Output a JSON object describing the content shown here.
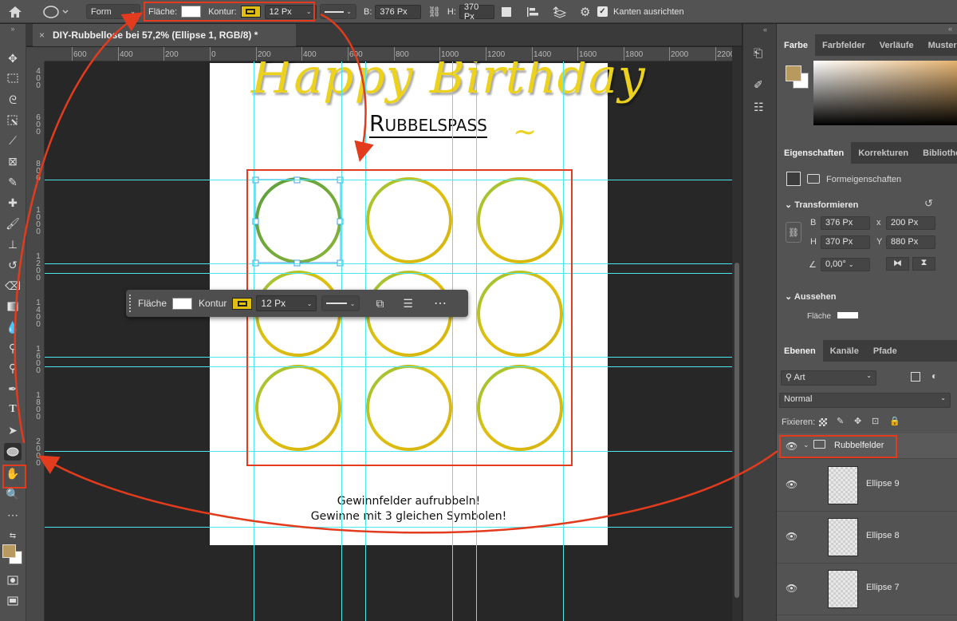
{
  "options_bar": {
    "mode": "Form",
    "fill_label": "Fläche:",
    "stroke_label": "Kontur:",
    "stroke_width": "12 Px",
    "width_label": "B:",
    "width_value": "376 Px",
    "height_label": "H:",
    "height_value": "370 Px",
    "align_edges_label": "Kanten ausrichten",
    "align_edges_checked": true
  },
  "tab": {
    "title": "DIY-Rubbellose bei 57,2% (Ellipse 1, RGB/8) *",
    "close": "×"
  },
  "rulers": {
    "horizontal": [
      "600",
      "400",
      "200",
      "0",
      "200",
      "400",
      "600",
      "800",
      "1000",
      "1200",
      "1400",
      "1600",
      "1800",
      "2000",
      "2200"
    ],
    "vertical": [
      "400",
      "600",
      "800",
      "1000",
      "1200",
      "1400",
      "1600",
      "1800",
      "2000"
    ]
  },
  "document": {
    "title_script": "Happy Birthday",
    "subtitle": "Rubbelspaß",
    "footer_line1": "Gewinnfelder aufrubbeln!",
    "footer_line2": "Gewinne mit 3 gleichen Symbolen!"
  },
  "contextual_bar": {
    "fill_label": "Fläche",
    "stroke_label": "Kontur",
    "stroke_width": "12 Px"
  },
  "color_panel": {
    "tabs": [
      "Farbe",
      "Farbfelder",
      "Verläufe",
      "Muster"
    ],
    "foreground": "#b89a5f",
    "background": "#ffffff"
  },
  "properties_panel": {
    "tabs": [
      "Eigenschaften",
      "Korrekturen",
      "Bibliothe"
    ],
    "kind": "Formeigenschaften",
    "transform_heading": "Transformieren",
    "w_label": "B",
    "w_value": "376 Px",
    "x_label": "x",
    "x_value": "200 Px",
    "h_label": "H",
    "h_value": "370 Px",
    "y_label": "Y",
    "y_value": "880 Px",
    "angle_value": "0,00°",
    "appearance_heading": "Aussehen",
    "fill_label": "Fläche"
  },
  "layers_panel": {
    "tabs": [
      "Ebenen",
      "Kanäle",
      "Pfade"
    ],
    "filter_kind": "Art",
    "blend_mode": "Normal",
    "lock_label": "Fixieren:",
    "group": "Rubbelfelder",
    "layers": [
      "Ellipse 9",
      "Ellipse 8",
      "Ellipse 7"
    ]
  },
  "colors": {
    "guide": "#4ce6ee",
    "annotation": "#e23b1d",
    "stroke_gold": "#e0bf10",
    "stroke_green": "#8cc63f"
  }
}
